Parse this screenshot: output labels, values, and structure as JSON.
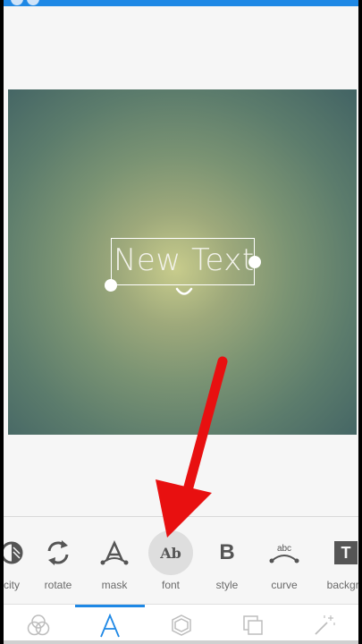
{
  "canvas": {
    "text_layer": {
      "content": "New Text"
    }
  },
  "toolbar": {
    "items": [
      {
        "label": "city",
        "icon": "opacity-icon"
      },
      {
        "label": "rotate",
        "icon": "rotate-icon"
      },
      {
        "label": "mask",
        "icon": "mask-icon"
      },
      {
        "label": "font",
        "icon": "font-icon",
        "icon_text": "Ab",
        "active": true
      },
      {
        "label": "style",
        "icon": "bold-icon",
        "icon_text": "B"
      },
      {
        "label": "curve",
        "icon": "curve-icon",
        "icon_text": "abc"
      },
      {
        "label": "backgro",
        "icon": "background-icon",
        "icon_text": "T"
      }
    ]
  },
  "bottom_nav": {
    "items": [
      {
        "icon": "blend-icon"
      },
      {
        "icon": "text-icon",
        "active": true
      },
      {
        "icon": "shape-icon"
      },
      {
        "icon": "layers-icon"
      },
      {
        "icon": "magic-wand-icon"
      }
    ]
  },
  "colors": {
    "accent": "#1e88e5",
    "annotation_arrow": "#e81010"
  }
}
